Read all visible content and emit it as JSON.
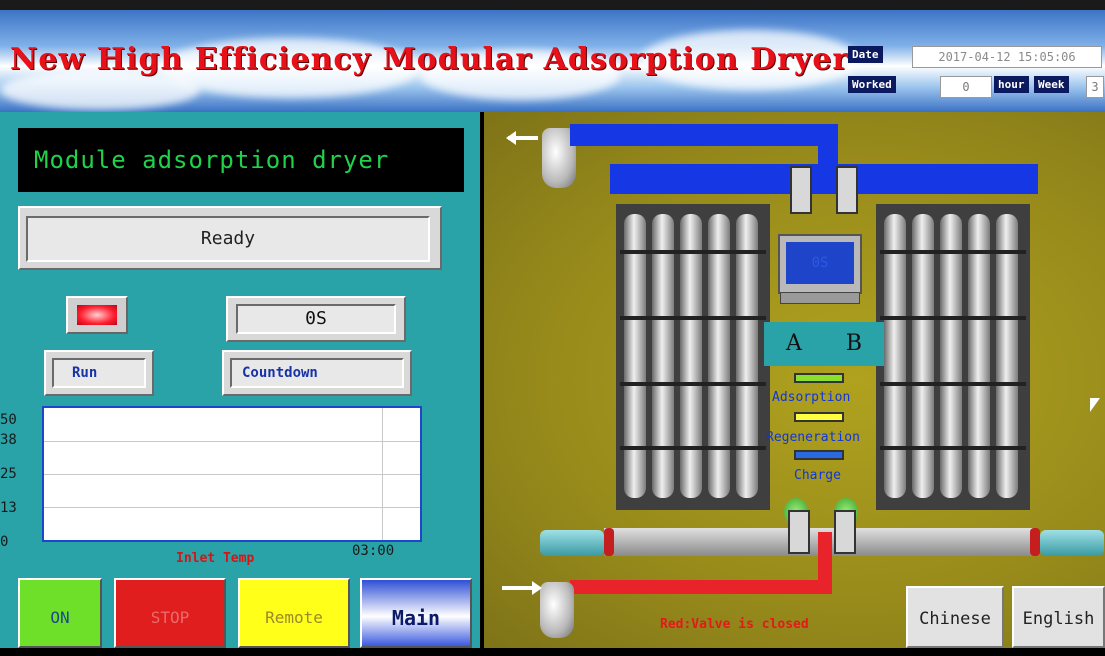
{
  "header": {
    "title": "New High Efficiency Modular Adsorption Dryer",
    "date_label": "Date",
    "date_value": "2017-04-12 15:05:06",
    "worked_label": "Worked",
    "worked_value": "0",
    "hour_label": "hour",
    "week_label": "Week",
    "week_value": "3"
  },
  "left": {
    "banner": "Module adsorption dryer",
    "status": "Ready",
    "seconds": "0S",
    "run_label": "Run",
    "countdown_label": "Countdown",
    "chart_y_ticks": [
      "50",
      "38",
      "25",
      "13",
      "0"
    ],
    "chart_x_label": "Inlet Temp",
    "chart_time": "03:00"
  },
  "buttons": {
    "on": "ON",
    "stop": "STOP",
    "remote": "Remote",
    "main": "Main"
  },
  "diagram": {
    "screen_value": "0S",
    "tower_a": "A",
    "tower_b": "B",
    "legend_adsorption": "Adsorption",
    "legend_regeneration": "Regeneration",
    "legend_charge": "Charge",
    "valve_note": "Red:Valve is closed"
  },
  "lang": {
    "chinese": "Chinese",
    "english": "English"
  },
  "colors": {
    "title_red": "#e8111a",
    "panel_teal": "#2aa3a8",
    "pipe_blue": "#1538e4",
    "on_green": "#6ee02a",
    "stop_red": "#e01e1e",
    "remote_yellow": "#ffff1a"
  }
}
